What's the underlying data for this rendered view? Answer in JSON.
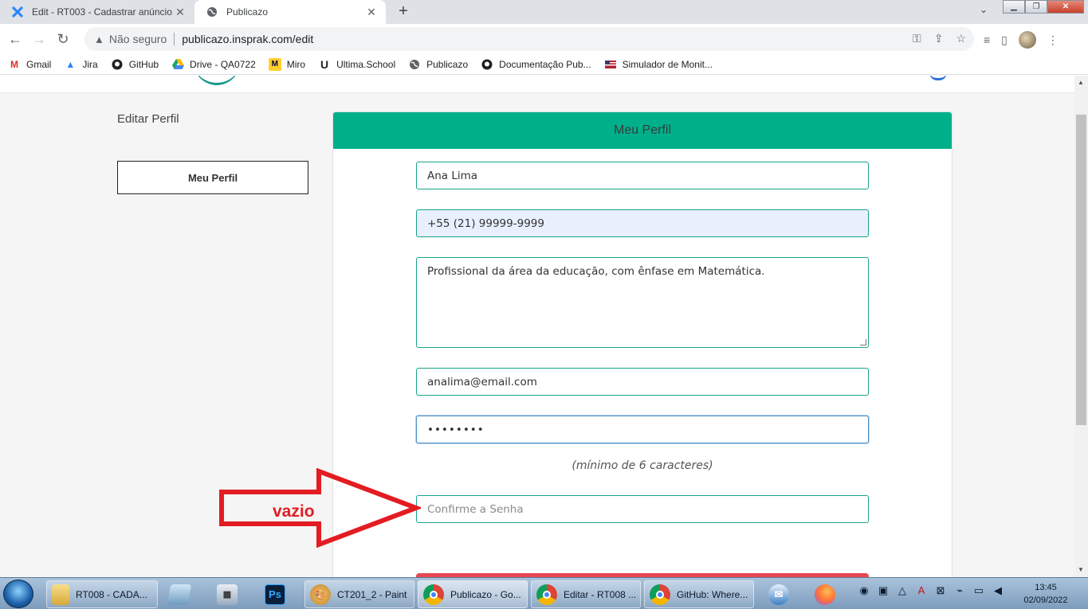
{
  "browser": {
    "tabs": [
      {
        "title": "Edit - RT003 - Cadastrar anúncio",
        "icon": "jira-icon",
        "active": false
      },
      {
        "title": "Publicazo",
        "icon": "globe-icon",
        "active": true
      }
    ],
    "new_tab": "+",
    "omnibox": {
      "security_label": "Não seguro",
      "url": "publicazo.insprak.com/edit"
    },
    "bookmarks": [
      {
        "label": "Gmail",
        "icon": "gmail-icon",
        "color": "#d93025"
      },
      {
        "label": "Jira",
        "icon": "jira-icon",
        "color": "#2684ff"
      },
      {
        "label": "GitHub",
        "icon": "github-icon",
        "color": "#202124"
      },
      {
        "label": "Drive - QA0722",
        "icon": "drive-icon",
        "color": "#1fa463"
      },
      {
        "label": "Miro",
        "icon": "miro-icon",
        "color": "#ffd02f"
      },
      {
        "label": "Ultima.School",
        "icon": "ultima-icon",
        "color": "#202124"
      },
      {
        "label": "Publicazo",
        "icon": "globe-icon",
        "color": "#5f6368"
      },
      {
        "label": "Documentação Pub...",
        "icon": "github-icon",
        "color": "#202124"
      },
      {
        "label": "Simulador de Monit...",
        "icon": "flag-icon",
        "color": "#b22234"
      }
    ]
  },
  "page": {
    "sidebar": {
      "title": "Editar Perfil",
      "menu_button": "Meu Perfil"
    },
    "card": {
      "header": "Meu Perfil",
      "accent_color": "#00b08b",
      "fields": {
        "name": "Ana Lima",
        "phone": "+55 (21) 99999-9999",
        "bio": "Profissional da área da educação, com ênfase em Matemática.",
        "email": "analima@email.com",
        "password": "••••••••",
        "password_hint": "(mínimo de 6 caracteres)",
        "confirm_password_placeholder": "Confirme a Senha"
      }
    },
    "annotation": {
      "label": "vazio",
      "color": "#e31c23"
    }
  },
  "taskbar": {
    "items": [
      {
        "label": "RT008 - CADA...",
        "icon": "folder-icon"
      },
      {
        "label": "CT201_2 - Paint",
        "icon": "paint-icon"
      },
      {
        "label": "Publicazo - Go...",
        "icon": "chrome-icon",
        "active": true
      },
      {
        "label": "Editar - RT008 ...",
        "icon": "chrome-icon"
      },
      {
        "label": "GitHub: Where...",
        "icon": "chrome-icon"
      }
    ],
    "clock": {
      "time": "13:45",
      "date": "02/09/2022"
    }
  }
}
